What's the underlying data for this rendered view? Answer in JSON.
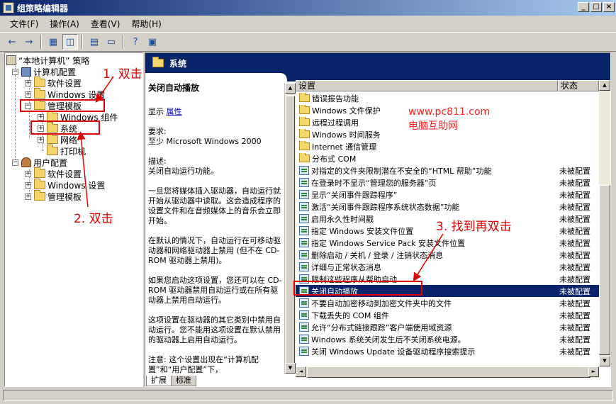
{
  "window": {
    "title": "组策略编辑器",
    "buttons": [
      "_",
      "□",
      "×"
    ]
  },
  "menu": [
    "文件(F)",
    "操作(A)",
    "查看(V)",
    "帮助(H)"
  ],
  "toolbar": {
    "icons": [
      "back-icon",
      "forward-icon",
      "up-folder-icon",
      "show-tree-icon",
      "properties-icon",
      "export-icon",
      "help-icon",
      "console-icon"
    ]
  },
  "tree": {
    "root": "“本地计算机” 策略",
    "computer_config": "计算机配置",
    "software_settings": "软件设置",
    "windows_settings": "Windows 设置",
    "admin_templates": "管理模板",
    "windows_components": "Windows 组件",
    "system": "系统",
    "network": "网络",
    "printers": "打印机",
    "user_config": "用户配置",
    "user_software_settings": "软件设置",
    "user_windows_settings": "Windows 设置",
    "user_admin_templates": "管理模板"
  },
  "right_header": "系统",
  "description": {
    "title": "关闭自动播放",
    "display_label": "显示",
    "properties_link": "属性",
    "requirements": "要求:\n至少 Microsoft Windows 2000",
    "desc_label": "描述:\n关闭自动运行功能。",
    "para1": "一旦您将媒体插入驱动器，自动运行就开始从驱动器中读取。这会造成程序的设置文件和在音频媒体上的音乐会立即开始。",
    "para2": "在默认的情况下，自动运行在可移动驱动器和网络驱动器上禁用 (但不在 CD-ROM 驱动器上禁用)。",
    "para3": "如果您启动这项设置，您还可以在 CD-ROM 驱动器禁用自动运行或在所有驱动器上禁用自动运行。",
    "para4": "这项设置在驱动器的其它类别中禁用自动运行。您不能用这项设置在默认禁用的驱动器上启用自动运行。",
    "para5": "注意: 这个设置出现在“计算机配置”和“用户配置”下，"
  },
  "list": {
    "col_setting": "设置",
    "col_state": "状态",
    "folders": [
      "错误报告功能",
      "Windows 文件保护",
      "远程过程调用",
      "Windows 时间服务",
      "Internet 通信管理",
      "分布式 COM"
    ],
    "settings": [
      {
        "name": "对指定的文件夹限制潜在不安全的“HTML 帮助”功能",
        "state": "未被配置"
      },
      {
        "name": "在登录时不显示“管理您的服务器”页",
        "state": "未被配置"
      },
      {
        "name": "显示“关闭事件跟踪程序”",
        "state": "未被配置"
      },
      {
        "name": "激活“关闭事件跟踪程序系统状态数据”功能",
        "state": "未被配置"
      },
      {
        "name": "启用永久性时间戳",
        "state": "未被配置"
      },
      {
        "name": "指定 Windows 安装文件位置",
        "state": "未被配置"
      },
      {
        "name": "指定 Windows Service Pack 安装文件位置",
        "state": "未被配置"
      },
      {
        "name": "删除启动 / 关机 / 登录 / 注销状态消息",
        "state": "未被配置"
      },
      {
        "name": "详细与正常状态消息",
        "state": "未被配置"
      },
      {
        "name": "限制这些程序从帮助启动",
        "state": "未被配置"
      },
      {
        "name": "关闭自动播放",
        "state": "未被配置"
      },
      {
        "name": "不要自动加密移动到加密文件夹中的文件",
        "state": "未被配置"
      },
      {
        "name": "下载丢失的 COM 组件",
        "state": "未被配置"
      },
      {
        "name": "允许“分布式链接跟踪”客户端使用域资源",
        "state": "未被配置"
      },
      {
        "name": "Windows 系统关闭发生后不关闭系统电源。",
        "state": "未被配置"
      },
      {
        "name": "关闭 Windows Update 设备驱动程序搜索提示",
        "state": "未被配置"
      }
    ]
  },
  "tabs": [
    "扩展",
    "标准"
  ],
  "annotations": {
    "step1": "1. 双击",
    "step2": "2. 双击",
    "step3": "3. 找到再双击"
  },
  "watermark": {
    "url": "www.pc811.com",
    "name": "电脑互助网"
  },
  "colors": {
    "selection": "#0a246a",
    "annotation": "#e00000",
    "face": "#d4d0c8"
  }
}
